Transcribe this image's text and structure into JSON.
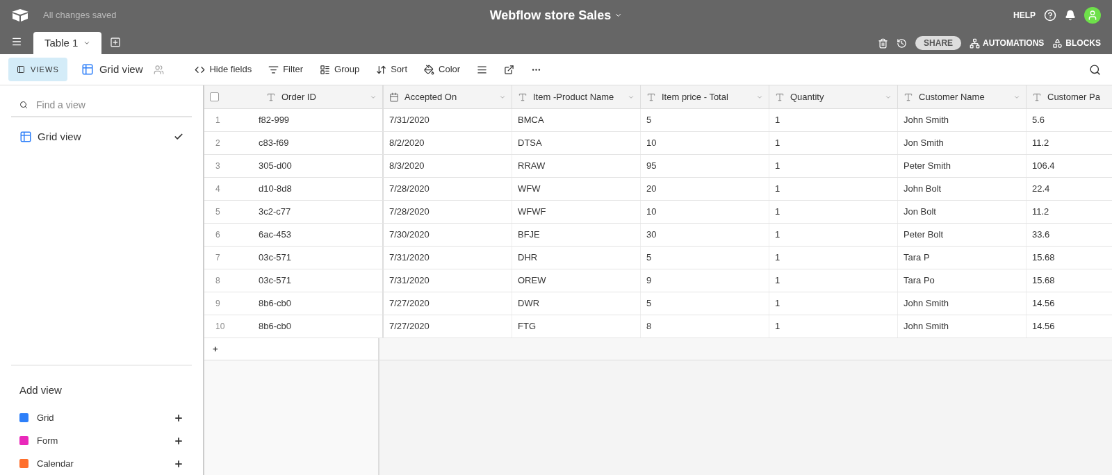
{
  "header": {
    "status": "All changes saved",
    "base_title": "Webflow store Sales",
    "help": "HELP"
  },
  "tabs": [
    {
      "label": "Table 1",
      "selected": true
    }
  ],
  "actions": {
    "share": "SHARE",
    "automations": "AUTOMATIONS",
    "blocks": "BLOCKS"
  },
  "toolbar": {
    "views": "VIEWS",
    "views_open": true,
    "view_name": "Grid view",
    "items": [
      {
        "kind": "hide",
        "label": "Hide fields"
      },
      {
        "kind": "filter",
        "label": "Filter"
      },
      {
        "kind": "group",
        "label": "Group"
      },
      {
        "kind": "sort",
        "label": "Sort"
      },
      {
        "kind": "color",
        "label": "Color"
      },
      {
        "kind": "height"
      },
      {
        "kind": "share"
      },
      {
        "kind": "more"
      }
    ]
  },
  "sidebar": {
    "search": {
      "placeholder": "Find a view"
    },
    "views": [
      {
        "label": "Grid view",
        "selected": true
      }
    ],
    "add_view_title": "Add view",
    "add_items": [
      {
        "label": "Grid",
        "color": "#2d7ff9"
      },
      {
        "label": "Form",
        "color": "#e929ba"
      },
      {
        "label": "Calendar",
        "color": "#ff6f2c"
      }
    ]
  },
  "table": {
    "select_all_checked": false,
    "columns": [
      {
        "label": "Order ID",
        "kind": "text"
      },
      {
        "label": "Accepted On",
        "kind": "date"
      },
      {
        "label": "Item -Product Name",
        "kind": "text"
      },
      {
        "label": "Item price - Total",
        "kind": "text"
      },
      {
        "label": "Quantity",
        "kind": "text"
      },
      {
        "label": "Customer Name",
        "kind": "text"
      },
      {
        "label": "Customer Pa",
        "kind": "text"
      }
    ],
    "rows": [
      {
        "n": "1",
        "cells": [
          "f82-999",
          "7/31/2020",
          "BMCA",
          "5",
          "1",
          "John Smith",
          "5.6"
        ]
      },
      {
        "n": "2",
        "cells": [
          "c83-f69",
          "8/2/2020",
          "DTSA",
          "10",
          "1",
          "Jon Smith",
          "11.2"
        ]
      },
      {
        "n": "3",
        "cells": [
          "305-d00",
          "8/3/2020",
          "RRAW",
          "95",
          "1",
          "Peter Smith",
          "106.4"
        ]
      },
      {
        "n": "4",
        "cells": [
          "d10-8d8",
          "7/28/2020",
          "WFW",
          "20",
          "1",
          "John Bolt",
          "22.4"
        ]
      },
      {
        "n": "5",
        "cells": [
          "3c2-c77",
          "7/28/2020",
          "WFWF",
          "10",
          "1",
          "Jon Bolt",
          "11.2"
        ]
      },
      {
        "n": "6",
        "cells": [
          "6ac-453",
          "7/30/2020",
          "BFJE",
          "30",
          "1",
          "Peter Bolt",
          "33.6"
        ]
      },
      {
        "n": "7",
        "cells": [
          "03c-571",
          "7/31/2020",
          "DHR",
          "5",
          "1",
          "Tara P",
          "15.68"
        ]
      },
      {
        "n": "8",
        "cells": [
          "03c-571",
          "7/31/2020",
          "OREW",
          "9",
          "1",
          "Tara Po",
          "15.68"
        ]
      },
      {
        "n": "9",
        "cells": [
          "8b6-cb0",
          "7/27/2020",
          "DWR",
          "5",
          "1",
          "John Smith",
          "14.56"
        ]
      },
      {
        "n": "10",
        "cells": [
          "8b6-cb0",
          "7/27/2020",
          "FTG",
          "8",
          "1",
          "John Smith",
          "14.56"
        ]
      }
    ],
    "add_row": "+"
  }
}
